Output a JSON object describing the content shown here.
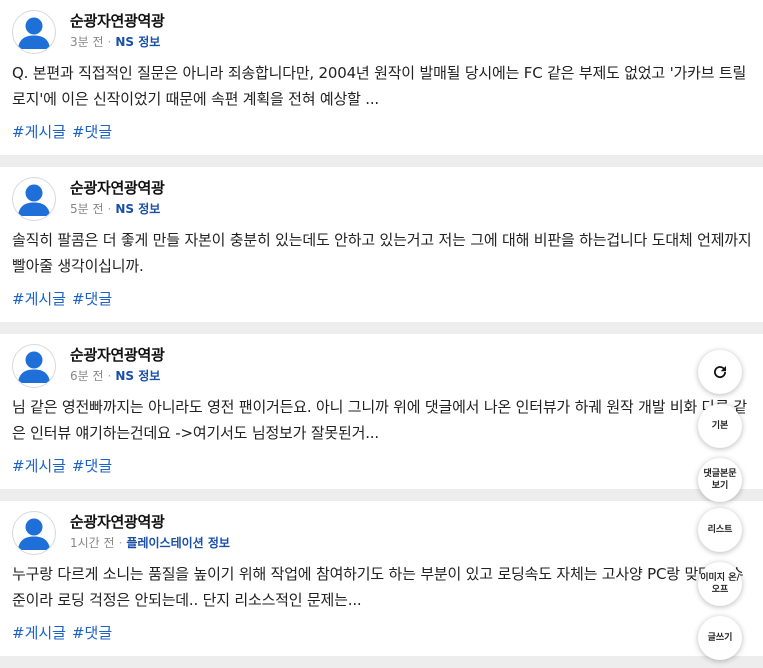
{
  "posts": [
    {
      "author": "순광자연광역광",
      "time": "3분 전",
      "category": "NS 정보",
      "body": "Q. 본편과 직접적인 질문은 아니라 죄송합니다만, 2004년 원작이 발매될 당시에는 FC 같은 부제도 없었고 '가카브 트릴로지'에 이은 신작이었기 때문에 속편 계획을 전혀 예상할 ...",
      "tags": [
        "#게시글",
        "#댓글"
      ]
    },
    {
      "author": "순광자연광역광",
      "time": "5분 전",
      "category": "NS 정보",
      "body": "솔직히 팔콤은 더 좋게 만들 자본이 충분히 있는데도 안하고 있는거고 저는 그에 대해 비판을 하는겁니다 도대체 언제까지 빨아줄 생각이십니까.",
      "tags": [
        "#게시글",
        "#댓글"
      ]
    },
    {
      "author": "순광자연광역광",
      "time": "6분 전",
      "category": "NS 정보",
      "body": "님 같은 영전빠까지는 아니라도 영전 팬이거든요. 아니 그니까 위에 댓글에서 나온 인터뷰가 하궤 원작 개발 비화 다룬 같은 인터뷰 얘기하는건데요 ->여기서도 님정보가 잘못된거...",
      "tags": [
        "#게시글",
        "#댓글"
      ]
    },
    {
      "author": "순광자연광역광",
      "time": "1시간 전",
      "category": "플레이스테이션 정보",
      "body": "누구랑 다르게 소니는 품질을 높이기 위해 작업에 참여하기도 하는 부분이 있고 로딩속도 자체는 고사양 PC랑 맞먹는 수준이라 로딩 걱정은 안되는데.. 단지 리소스적인 문제는...",
      "tags": [
        "#게시글",
        "#댓글"
      ]
    }
  ],
  "fabs": [
    {
      "name": "refresh-icon",
      "label": ""
    },
    {
      "name": "default-view-button",
      "label": "기본"
    },
    {
      "name": "comment-body-view-button",
      "label": "댓글본문\n보기"
    },
    {
      "name": "list-view-button",
      "label": "리스트"
    },
    {
      "name": "image-toggle-button",
      "label": "이미지 온/\n오프"
    },
    {
      "name": "write-button",
      "label": "글쓰기"
    }
  ]
}
